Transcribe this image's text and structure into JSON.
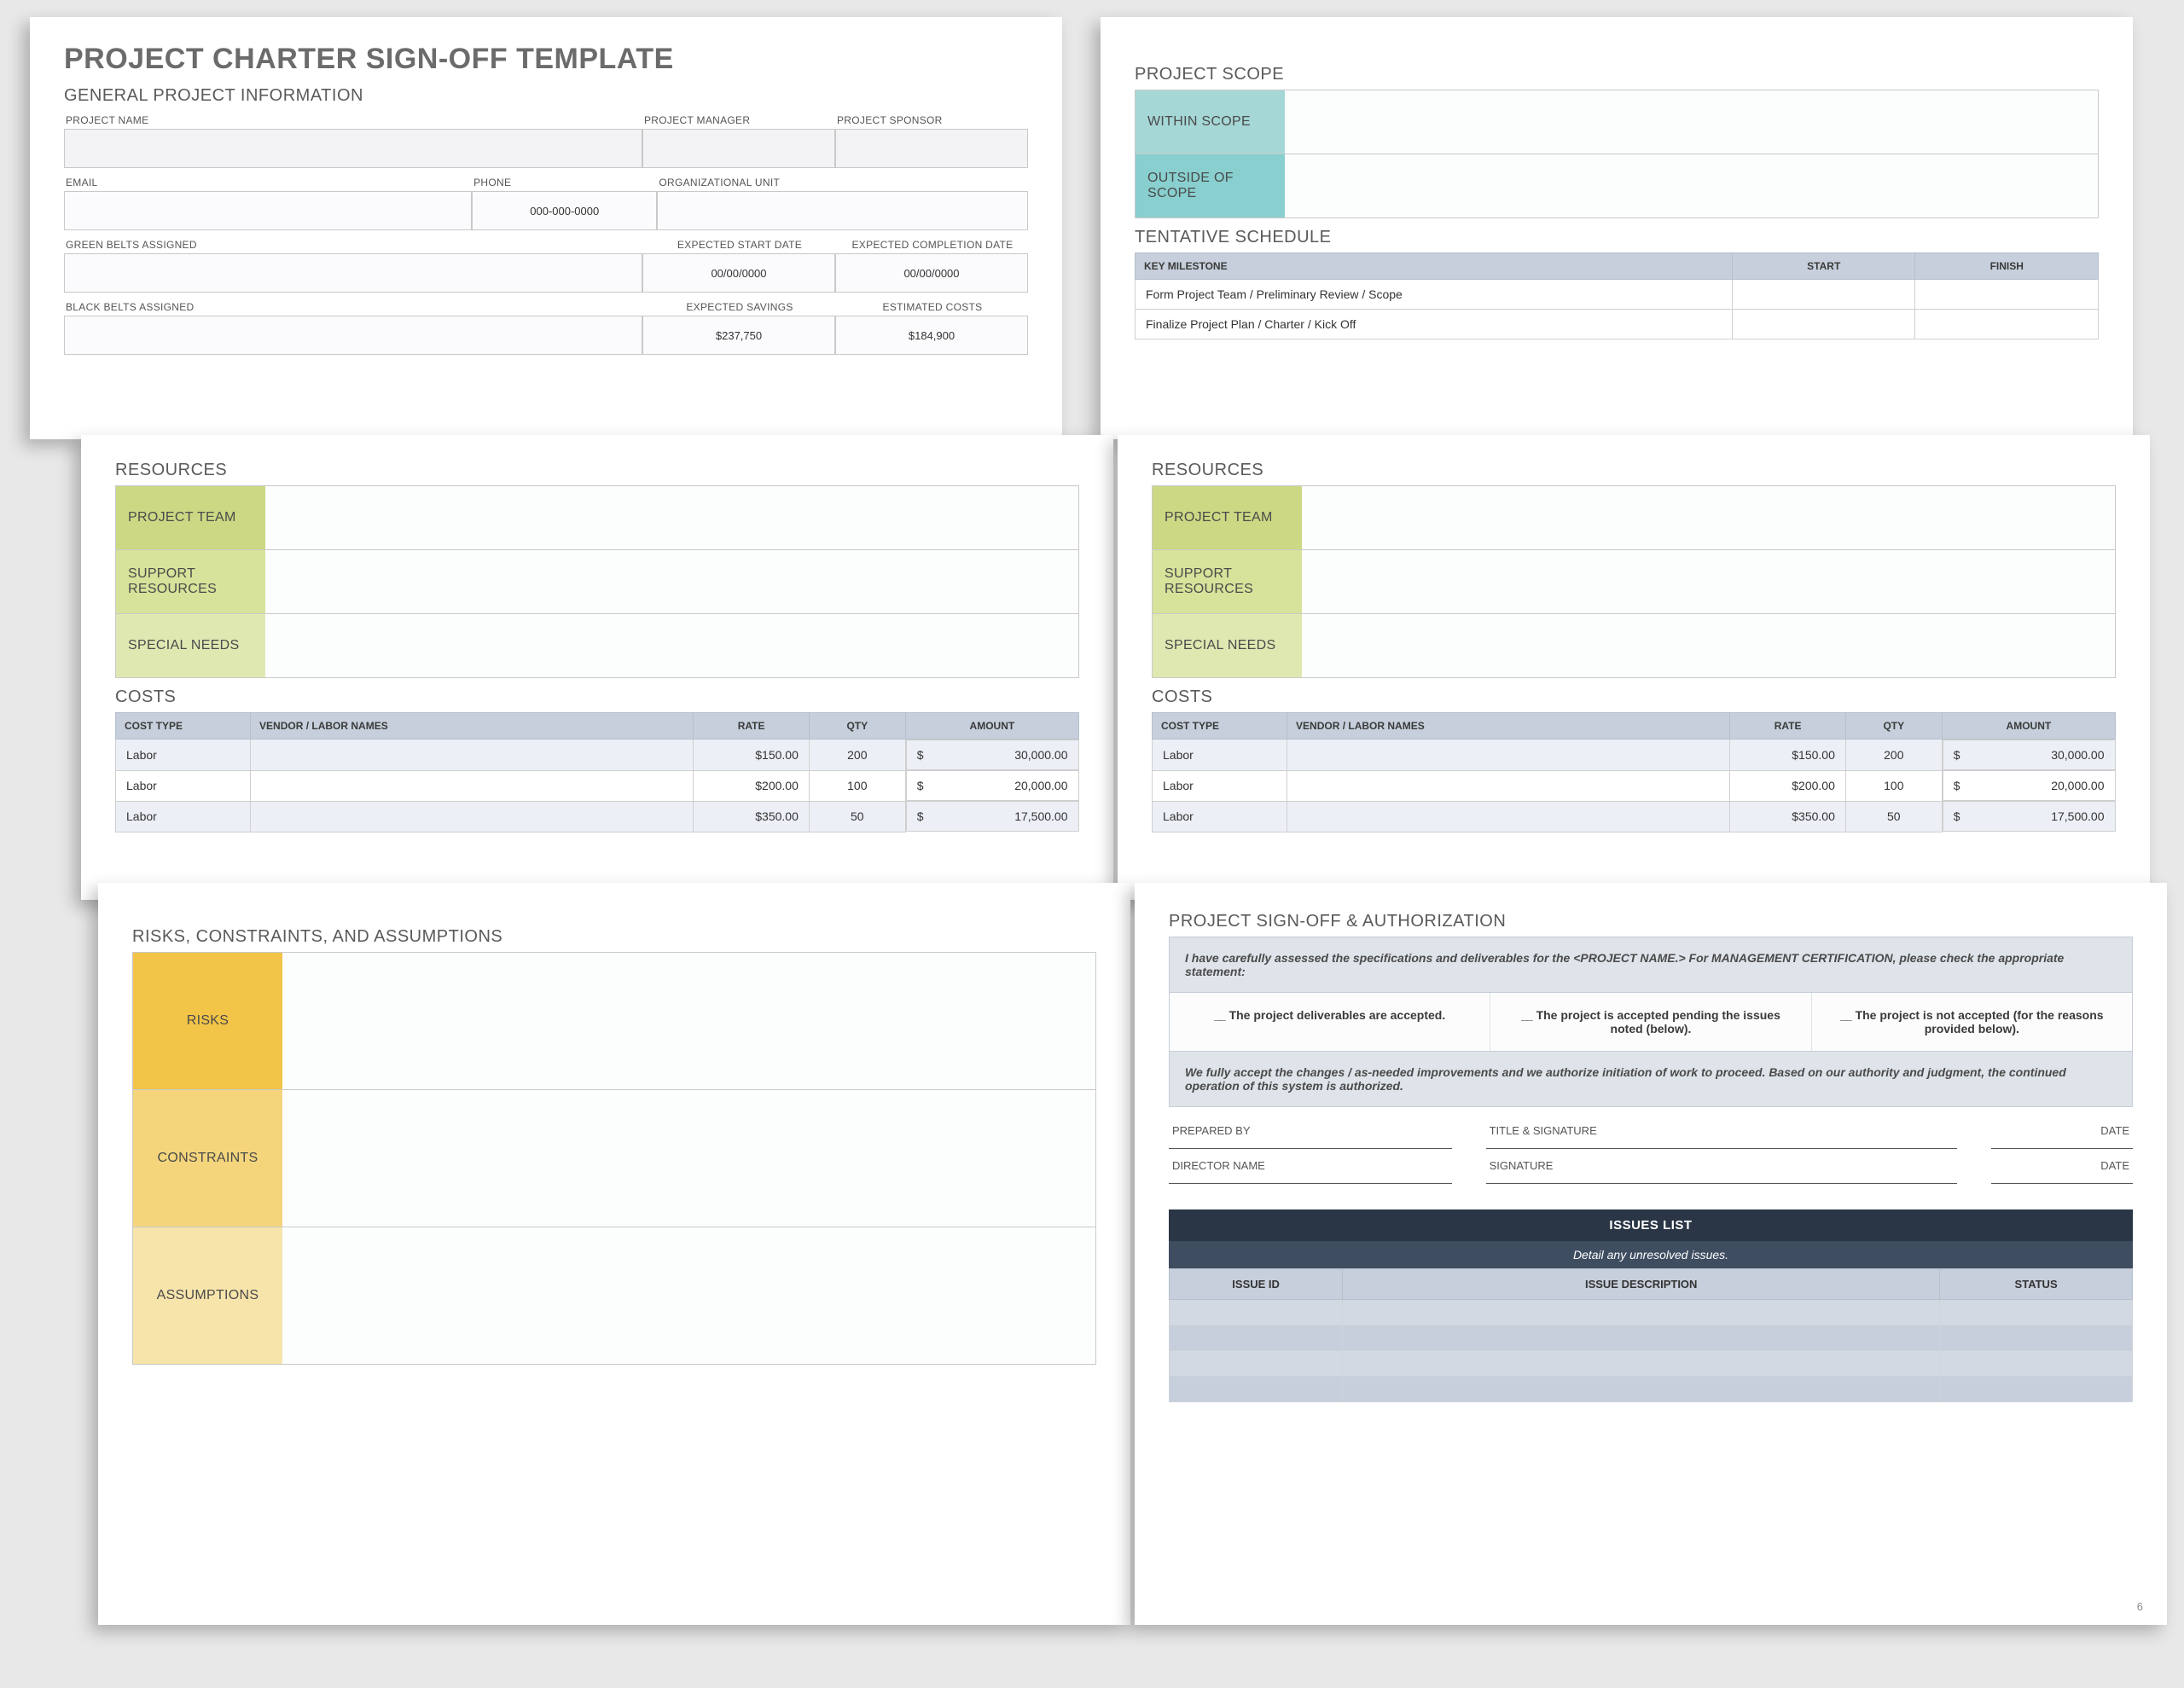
{
  "title": "PROJECT CHARTER SIGN-OFF TEMPLATE",
  "general": {
    "heading": "GENERAL PROJECT INFORMATION",
    "labels": {
      "project_name": "PROJECT NAME",
      "project_manager": "PROJECT MANAGER",
      "project_sponsor": "PROJECT SPONSOR",
      "email": "EMAIL",
      "phone": "PHONE",
      "org_unit": "ORGANIZATIONAL UNIT",
      "green_belts": "GREEN BELTS ASSIGNED",
      "exp_start": "EXPECTED START DATE",
      "exp_complete": "EXPECTED COMPLETION DATE",
      "black_belts": "BLACK BELTS ASSIGNED",
      "exp_savings": "EXPECTED SAVINGS",
      "est_costs": "ESTIMATED COSTS"
    },
    "values": {
      "phone": "000-000-0000",
      "exp_start": "00/00/0000",
      "exp_complete": "00/00/0000",
      "exp_savings": "$237,750",
      "est_costs": "$184,900"
    }
  },
  "scope": {
    "heading": "PROJECT SCOPE",
    "rows": [
      "WITHIN SCOPE",
      "OUTSIDE OF SCOPE"
    ]
  },
  "schedule": {
    "heading": "TENTATIVE SCHEDULE",
    "headers": [
      "KEY MILESTONE",
      "START",
      "FINISH"
    ],
    "rows": [
      "Form Project Team / Preliminary Review / Scope",
      "Finalize Project Plan / Charter / Kick Off"
    ]
  },
  "resources": {
    "heading": "RESOURCES",
    "rows": [
      "PROJECT TEAM",
      "SUPPORT RESOURCES",
      "SPECIAL NEEDS"
    ]
  },
  "costs": {
    "heading": "COSTS",
    "headers": [
      "COST TYPE",
      "VENDOR / LABOR NAMES",
      "RATE",
      "QTY",
      "AMOUNT"
    ],
    "rows": [
      {
        "type": "Labor",
        "vendor": "",
        "rate": "$150.00",
        "qty": "200",
        "cur": "$",
        "amount": "30,000.00"
      },
      {
        "type": "Labor",
        "vendor": "",
        "rate": "$200.00",
        "qty": "100",
        "cur": "$",
        "amount": "20,000.00"
      },
      {
        "type": "Labor",
        "vendor": "",
        "rate": "$350.00",
        "qty": "50",
        "cur": "$",
        "amount": "17,500.00"
      }
    ]
  },
  "rca": {
    "heading": "RISKS, CONSTRAINTS, AND ASSUMPTIONS",
    "rows": [
      "RISKS",
      "CONSTRAINTS",
      "ASSUMPTIONS"
    ]
  },
  "signoff": {
    "heading": "PROJECT SIGN-OFF & AUTHORIZATION",
    "note1": "I have carefully assessed the specifications and deliverables for the <PROJECT NAME.> For MANAGEMENT CERTIFICATION, please check the appropriate statement:",
    "options": [
      "The project deliverables are accepted.",
      "The project is accepted pending the issues noted (below).",
      "The project is not accepted (for the reasons provided below)."
    ],
    "note2": "We fully accept the changes / as-needed improvements and we authorize initiation of work to proceed. Based on our authority and judgment, the continued operation of this system is authorized.",
    "sig_labels": {
      "prepared_by": "PREPARED BY",
      "title_sig": "TITLE & SIGNATURE",
      "date": "DATE",
      "director": "DIRECTOR NAME",
      "signature": "SIGNATURE"
    },
    "issues": {
      "title": "ISSUES LIST",
      "sub": "Detail any unresolved issues.",
      "headers": [
        "ISSUE ID",
        "ISSUE DESCRIPTION",
        "STATUS"
      ]
    },
    "page_number": "6"
  }
}
